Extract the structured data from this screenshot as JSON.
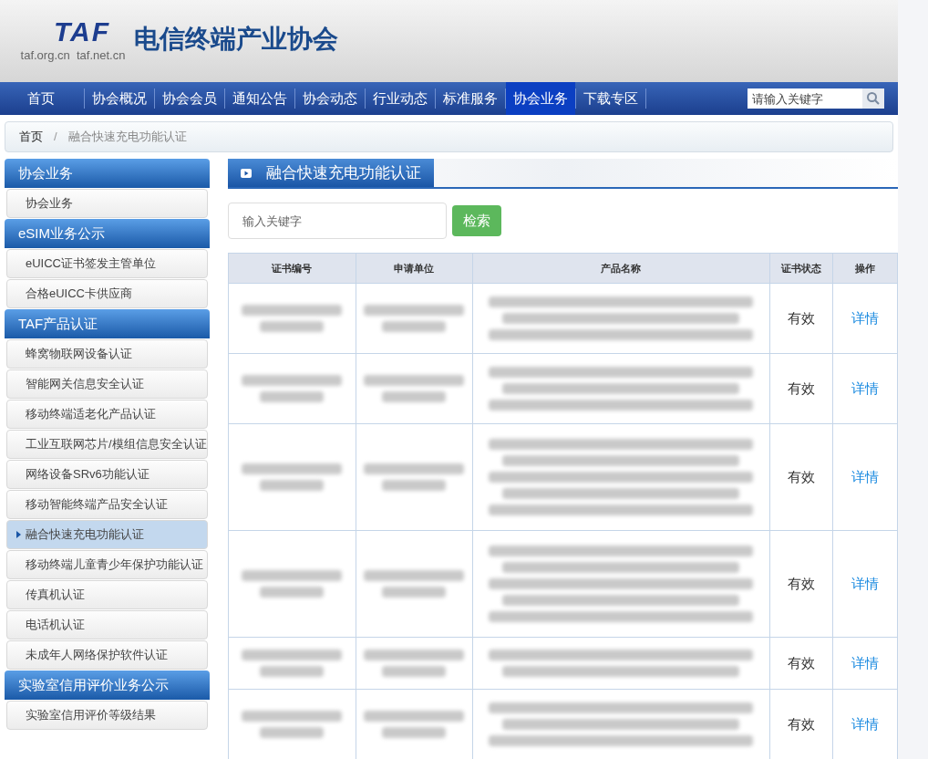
{
  "logo": {
    "mark": "TAF",
    "domains": "taf.org.cn  taf.net.cn"
  },
  "site_title": "电信终端产业协会",
  "nav": [
    {
      "label": "首页",
      "selected": false
    },
    {
      "label": "协会概况",
      "selected": false
    },
    {
      "label": "协会会员",
      "selected": false
    },
    {
      "label": "通知公告",
      "selected": false
    },
    {
      "label": "协会动态",
      "selected": false
    },
    {
      "label": "行业动态",
      "selected": false
    },
    {
      "label": "标准服务",
      "selected": false
    },
    {
      "label": "协会业务",
      "selected": true
    },
    {
      "label": "下载专区",
      "selected": false
    }
  ],
  "search": {
    "placeholder": "请输入关键字"
  },
  "breadcrumb": [
    "首页",
    "融合快速充电功能认证"
  ],
  "breadcrumb_separator": "/",
  "sidebar": [
    {
      "title": "协会业务",
      "items": [
        {
          "label": "协会业务",
          "selected": false
        }
      ]
    },
    {
      "title": "eSIM业务公示",
      "items": [
        {
          "label": "eUICC证书签发主管单位",
          "selected": false
        },
        {
          "label": "合格eUICC卡供应商",
          "selected": false
        }
      ]
    },
    {
      "title": "TAF产品认证",
      "items": [
        {
          "label": "蜂窝物联网设备认证",
          "selected": false
        },
        {
          "label": "智能网关信息安全认证",
          "selected": false
        },
        {
          "label": "移动终端适老化产品认证",
          "selected": false
        },
        {
          "label": "工业互联网芯片/模组信息安全认证",
          "selected": false
        },
        {
          "label": "网络设备SRv6功能认证",
          "selected": false
        },
        {
          "label": "移动智能终端产品安全认证",
          "selected": false
        },
        {
          "label": "融合快速充电功能认证",
          "selected": true
        },
        {
          "label": "移动终端儿童青少年保护功能认证",
          "selected": false
        },
        {
          "label": "传真机认证",
          "selected": false
        },
        {
          "label": "电话机认证",
          "selected": false
        },
        {
          "label": "未成年人网络保护软件认证",
          "selected": false
        }
      ]
    },
    {
      "title": "实验室信用评价业务公示",
      "items": [
        {
          "label": "实验室信用评价等级结果",
          "selected": false
        }
      ]
    }
  ],
  "content": {
    "title": "融合快速充电功能认证",
    "keyword_field": {
      "placeholder": "输入关键字"
    },
    "search_button": "检索",
    "table": {
      "columns": [
        "证书编号",
        "申请单位",
        "产品名称",
        "证书状态",
        "操作"
      ],
      "rows": [
        {
          "status": "有效",
          "action": "详情"
        },
        {
          "status": "有效",
          "action": "详情"
        },
        {
          "status": "有效",
          "action": "详情"
        },
        {
          "status": "有效",
          "action": "详情"
        },
        {
          "status": "有效",
          "action": "详情"
        },
        {
          "status": "有效",
          "action": "详情"
        }
      ]
    }
  }
}
